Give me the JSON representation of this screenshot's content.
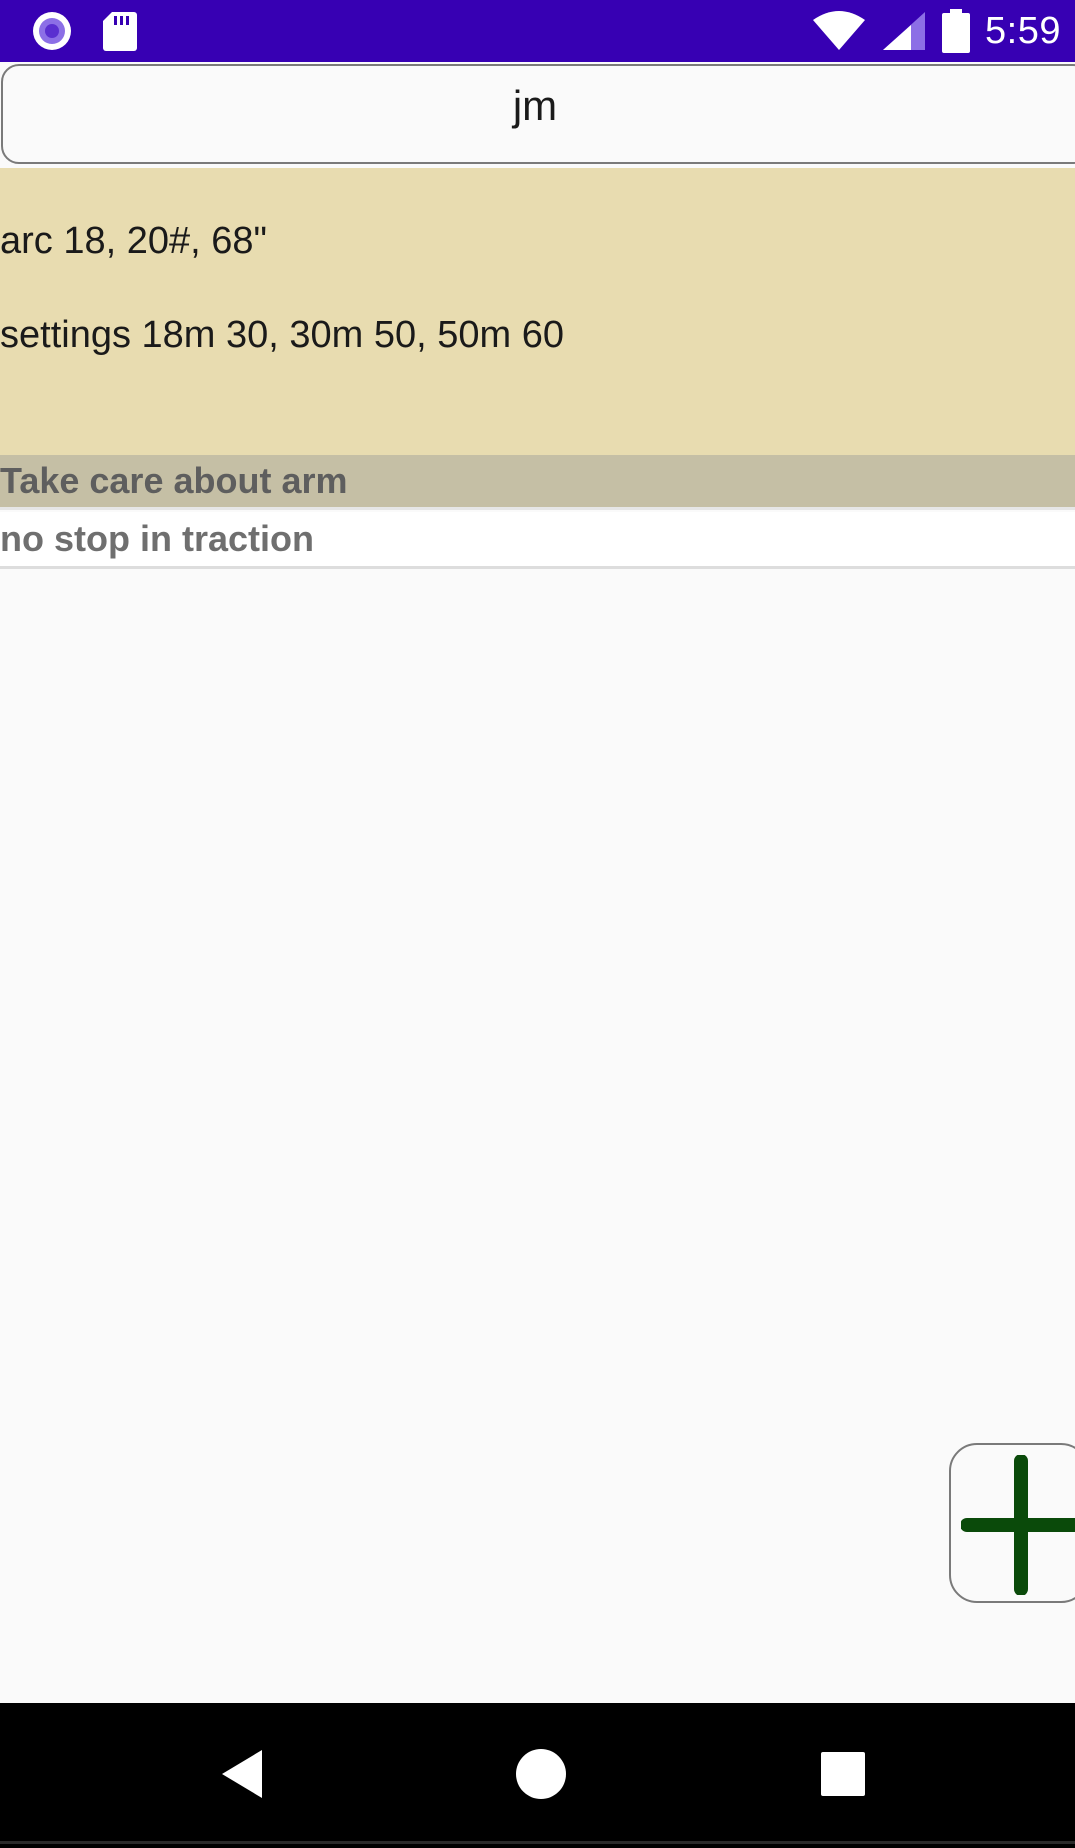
{
  "status_bar": {
    "time": "5:59",
    "left_icons": [
      "notification-circle-icon",
      "sd-card-icon"
    ],
    "right_icons": [
      "wifi-icon",
      "cell-signal-icon",
      "battery-icon"
    ],
    "background_color": "#3700b3"
  },
  "title_field": {
    "value": "jm"
  },
  "info_panel": {
    "line1": "arc 18, 20#, 68\"",
    "line2": "settings 18m 30, 30m 50, 50m 60",
    "background_color": "#e8dcb0"
  },
  "notes": [
    {
      "text": "Take care about arm",
      "background_color": "#c5bfa5"
    },
    {
      "text": "no stop in traction",
      "background_color": "#ffffff"
    }
  ],
  "add_button": {
    "icon": "plus-icon",
    "color": "#0a4a0a"
  },
  "nav_bar": {
    "icons": [
      "back-icon",
      "home-icon",
      "recents-icon"
    ]
  }
}
